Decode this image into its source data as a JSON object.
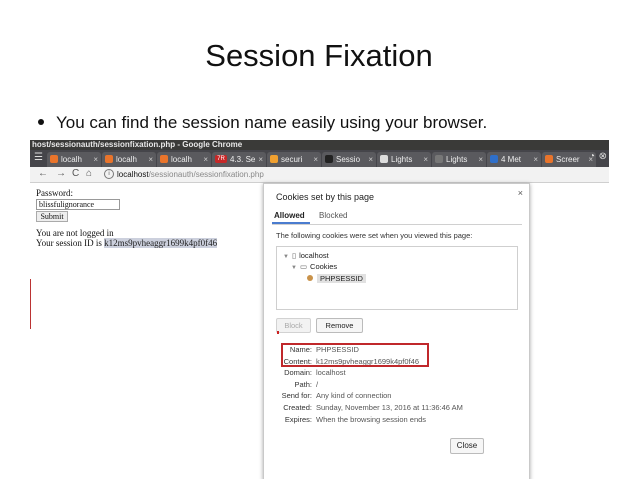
{
  "slide": {
    "title": "Session Fixation",
    "bullet": "You can find the session name easily using your browser."
  },
  "browser": {
    "window_title": "host/sessionauth/sessionfixation.php - Google Chrome",
    "tabs": [
      {
        "label": "localh",
        "icon_color": "#e9742b"
      },
      {
        "label": "localh",
        "icon_color": "#e9742b"
      },
      {
        "label": "localh",
        "icon_color": "#e9742b"
      },
      {
        "label": "4.3. Se",
        "icon_color": "#c62828",
        "icon_text": "7R"
      },
      {
        "label": "securi",
        "icon_color": "#f0a030"
      },
      {
        "label": "Sessio",
        "icon_color": "#222222"
      },
      {
        "label": "Lights",
        "icon_color": "#dddddd"
      },
      {
        "label": "Lights",
        "icon_color": "#777777"
      },
      {
        "label": "4 Met",
        "icon_color": "#2f6fc9"
      },
      {
        "label": "Screer",
        "icon_color": "#e9742b"
      }
    ],
    "tab_close_glyph": "×",
    "url_host": "localhost",
    "url_path": "/sessionauth/sessionfixation.php"
  },
  "page": {
    "password_label": "Password:",
    "password_value": "blissfulignorance",
    "submit_label": "Submit",
    "not_logged_in": "You are not logged in",
    "session_prefix": "Your session ID is ",
    "session_id": "k12ms9pvheaggr1699k4pf0f46"
  },
  "dialog": {
    "title": "Cookies set by this page",
    "close_glyph": "×",
    "tabs": [
      "Allowed",
      "Blocked"
    ],
    "description": "The following cookies were set when you viewed this page:",
    "tree": {
      "host": "localhost",
      "folder": "Cookies",
      "cookie": "PHPSESSID"
    },
    "block_label": "Block",
    "remove_label": "Remove",
    "details": [
      {
        "key": "Name:",
        "value": "PHPSESSID"
      },
      {
        "key": "Content:",
        "value": "k12ms9pvheaggr1699k4pf0f46"
      },
      {
        "key": "Domain:",
        "value": "localhost"
      },
      {
        "key": "Path:",
        "value": "/"
      },
      {
        "key": "Send for:",
        "value": "Any kind of connection"
      },
      {
        "key": "Created:",
        "value": "Sunday, November 13, 2016 at 11:36:46 AM"
      },
      {
        "key": "Expires:",
        "value": "When the browsing session ends"
      }
    ],
    "close_label": "Close"
  }
}
